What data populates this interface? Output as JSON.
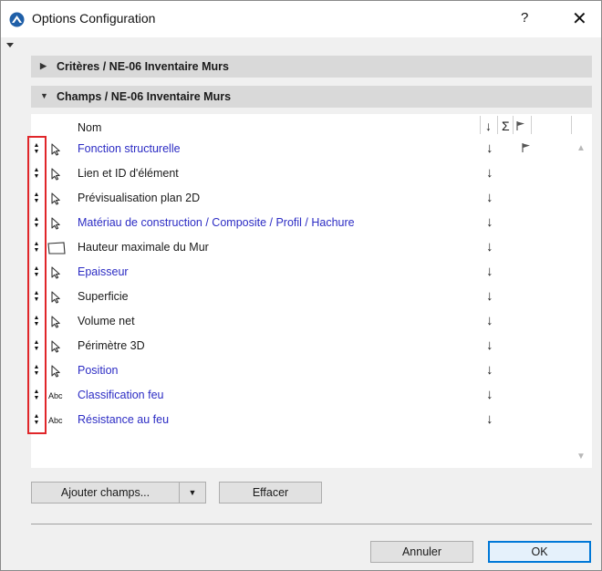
{
  "window": {
    "title": "Options Configuration",
    "help": "?",
    "close": "✕"
  },
  "sections": [
    {
      "label": "Critères / NE-06 Inventaire Murs",
      "expanded": false,
      "arrow": "▶"
    },
    {
      "label": "Champs / NE-06 Inventaire Murs",
      "expanded": true,
      "arrow": "▼"
    }
  ],
  "list": {
    "column_name": "Nom",
    "column_sort": "↓",
    "column_sum": "Σ",
    "column_flag_icon": "flag-icon",
    "rows": [
      {
        "name": "Fonction structurelle",
        "link": true,
        "icon": "arrow-pointer-icon",
        "sort": "↓",
        "flag": true
      },
      {
        "name": "Lien et ID d'élément",
        "link": false,
        "icon": "arrow-pointer-icon",
        "sort": "↓",
        "flag": false
      },
      {
        "name": "Prévisualisation plan 2D",
        "link": false,
        "icon": "arrow-pointer-icon",
        "sort": "↓",
        "flag": false
      },
      {
        "name": "Matériau de construction / Composite / Profil / Hachure",
        "link": true,
        "icon": "arrow-pointer-icon",
        "sort": "↓",
        "flag": false
      },
      {
        "name": "Hauteur maximale du Mur",
        "link": false,
        "icon": "wall-shape-icon",
        "sort": "↓",
        "flag": false
      },
      {
        "name": "Epaisseur",
        "link": true,
        "icon": "arrow-pointer-icon",
        "sort": "↓",
        "flag": false
      },
      {
        "name": "Superficie",
        "link": false,
        "icon": "arrow-pointer-icon",
        "sort": "↓",
        "flag": false
      },
      {
        "name": "Volume net",
        "link": false,
        "icon": "arrow-pointer-icon",
        "sort": "↓",
        "flag": false
      },
      {
        "name": "Périmètre 3D",
        "link": false,
        "icon": "arrow-pointer-icon",
        "sort": "↓",
        "flag": false
      },
      {
        "name": "Position",
        "link": true,
        "icon": "arrow-pointer-icon",
        "sort": "↓",
        "flag": false
      },
      {
        "name": "Classification feu",
        "link": true,
        "icon": "abc-text-icon",
        "icon_text": "Abc",
        "sort": "↓",
        "flag": false
      },
      {
        "name": "Résistance au feu",
        "link": true,
        "icon": "abc-text-icon",
        "icon_text": "Abc",
        "sort": "↓",
        "flag": false
      }
    ]
  },
  "buttons": {
    "add_fields": "Ajouter champs...",
    "add_dropdown": "▼",
    "clear": "Effacer",
    "cancel": "Annuler",
    "ok": "OK"
  },
  "colors": {
    "link_text": "#2c2cc4",
    "highlight_box": "#e0262a",
    "section_header_bg": "#d9d9d9",
    "ok_border": "#0078d7"
  }
}
